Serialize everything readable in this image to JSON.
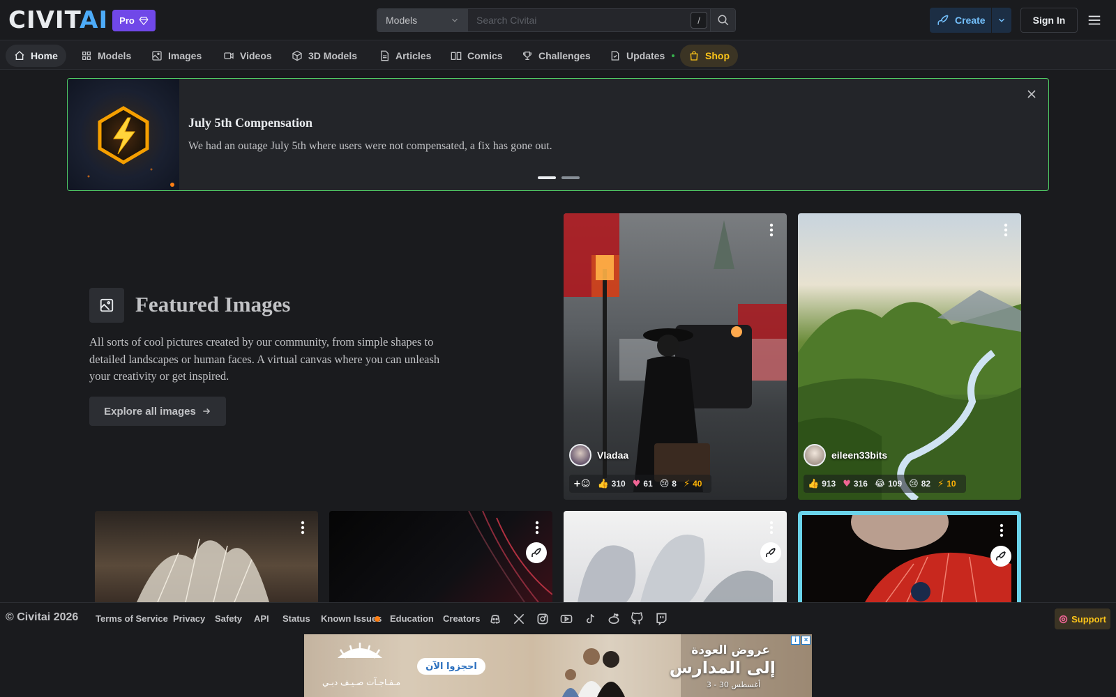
{
  "header": {
    "logo_text_a": "CIVIT",
    "logo_text_b": "AI",
    "pro_label": "Pro",
    "search_scope": "Models",
    "search_placeholder": "Search Civitai",
    "search_shortcut": "/",
    "create_label": "Create",
    "signin_label": "Sign In"
  },
  "nav": {
    "items": [
      {
        "label": "Home",
        "icon": "home-icon"
      },
      {
        "label": "Models",
        "icon": "grid-icon"
      },
      {
        "label": "Images",
        "icon": "image-icon"
      },
      {
        "label": "Videos",
        "icon": "video-icon"
      },
      {
        "label": "3D Models",
        "icon": "cube-icon"
      },
      {
        "label": "Articles",
        "icon": "article-icon"
      },
      {
        "label": "Comics",
        "icon": "book-icon"
      },
      {
        "label": "Challenges",
        "icon": "trophy-icon"
      },
      {
        "label": "Updates",
        "icon": "updates-icon"
      },
      {
        "label": "Shop",
        "icon": "shopping-bag-icon"
      }
    ]
  },
  "banner": {
    "title": "July 5th Compensation",
    "text": "We had an outage July 5th where users were not compensated, a fix has gone out."
  },
  "featured": {
    "title": "Featured Images",
    "description": "All sorts of cool pictures created by our community, from simple shapes to detailed landscapes or human faces. A virtual canvas where you can unleash your creativity or get inspired.",
    "explore_label": "Explore all images"
  },
  "cards": [
    {
      "username": "Vladaa",
      "reactions": {
        "like": "310",
        "heart": "61",
        "cry": "8",
        "buzz": "40"
      }
    },
    {
      "username": "eileen33bits",
      "reactions": {
        "like": "913",
        "heart": "316",
        "laugh": "109",
        "cry": "82",
        "buzz": "10"
      }
    }
  ],
  "footer": {
    "copyright": "© Civitai 2026",
    "links": [
      "Terms of Service",
      "Privacy",
      "Safety",
      "API",
      "Status",
      "Known Issues",
      "Education",
      "Creators"
    ],
    "support_label": "Support"
  },
  "ad": {
    "line1": "عروض العودة",
    "line2": "إلى المدارس",
    "line3": "3 - 30 أغسطس",
    "cta": "احجزوا الآن",
    "brand": "مـفـاجـآت صـيـف دبـي"
  },
  "colors": {
    "accent_blue": "#4dabf7",
    "pro_purple": "#7048e8",
    "banner_border": "#51cf66",
    "shop_yellow": "#fcc419"
  }
}
